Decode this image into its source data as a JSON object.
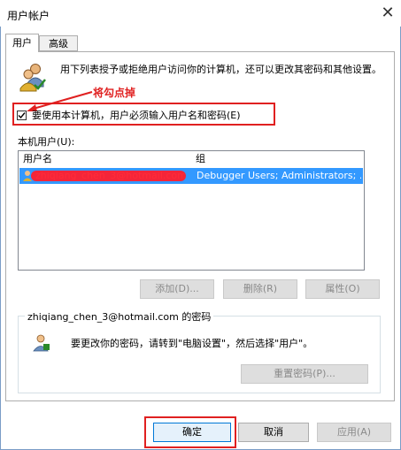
{
  "window": {
    "title": "用户帐户",
    "close_glyph": "✕"
  },
  "tabs": [
    {
      "label": "用户",
      "active": true
    },
    {
      "label": "高级",
      "active": false
    }
  ],
  "main": {
    "description": "用下列表授予或拒绝用户访问你的计算机，还可以更改其密码和其他设置。",
    "annotation": "将勾点掉",
    "checkbox_label": "要使用本计算机，用户必须输入用户名和密码(E)",
    "checkbox_checked": true,
    "users_label": "本机用户(U):",
    "table": {
      "columns": [
        "用户名",
        "组"
      ],
      "rows": [
        {
          "username": "zhiqiang_chen_3@hotmail.com",
          "group": "Debugger Users; Administrators; ..."
        }
      ]
    },
    "buttons": {
      "add": "添加(D)...",
      "remove": "删除(R)",
      "properties": "属性(O)"
    }
  },
  "password_group": {
    "label": "zhiqiang_chen_3@hotmail.com 的密码",
    "text": "要更改你的密码，请转到\"电脑设置\"，然后选择\"用户\"。",
    "reset_button": "重置密码(P)..."
  },
  "footer": {
    "ok": "确定",
    "cancel": "取消",
    "apply": "应用(A)"
  },
  "colors": {
    "annotation": "#e02020",
    "selection": "#3399ff"
  }
}
